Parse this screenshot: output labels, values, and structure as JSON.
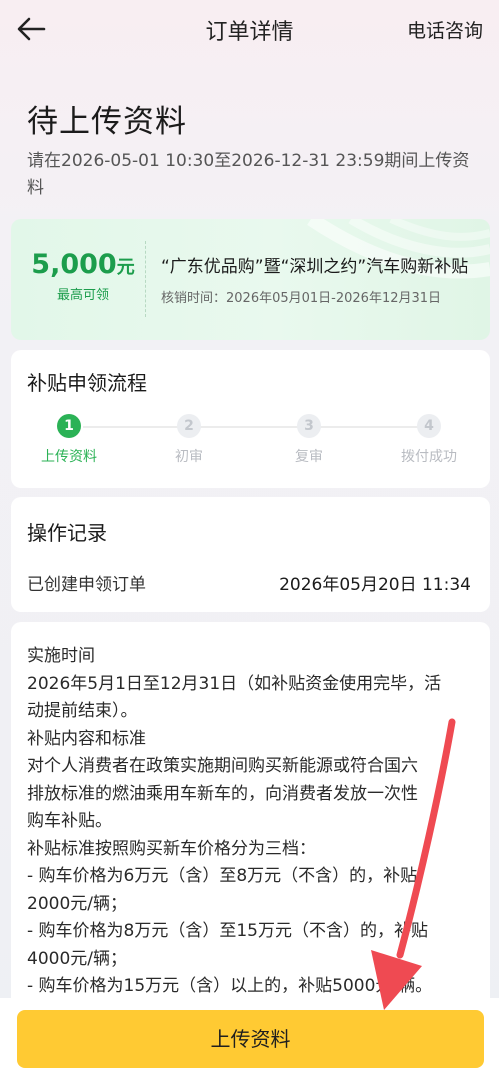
{
  "nav": {
    "title": "订单详情",
    "right_link": "电话咨询",
    "back_icon": "back-arrow-icon"
  },
  "status": {
    "title": "待上传资料",
    "desc": "请在2026-05-01 10:30至2026-12-31 23:59期间上传资料"
  },
  "promo": {
    "amount": "5,000",
    "unit": "元",
    "amount_label": "最高可领",
    "name": "“广东优品购”暨“深圳之约”汽车购新补贴",
    "period": "核销时间：2026年05月01日-2026年12月31日"
  },
  "flow": {
    "title": "补贴申领流程",
    "steps": [
      {
        "num": "1",
        "label": "上传资料",
        "active": true
      },
      {
        "num": "2",
        "label": "初审",
        "active": false
      },
      {
        "num": "3",
        "label": "复审",
        "active": false
      },
      {
        "num": "4",
        "label": "拨付成功",
        "active": false
      }
    ]
  },
  "log": {
    "title": "操作记录",
    "row_label": "已创建申领订单",
    "row_time": "2026年05月20日 11:34"
  },
  "info": {
    "lines": [
      "实施时间",
      "2026年5月1日至12月31日（如补贴资金使用完毕，活",
      "动提前结束）。",
      "补贴内容和标准",
      "对个人消费者在政策实施期间购买新能源或符合国六",
      "排放标准的燃油乘用车新车的，向消费者发放一次性",
      "购车补贴。",
      "补贴标准按照购买新车价格分为三档：",
      "- 购车价格为6万元（含）至8万元（不含）的，补贴",
      "2000元/辆；",
      "- 购车价格为8万元（含）至15万元（不含）的，补贴",
      "4000元/辆；",
      "- 购车价格为15万元（含）以上的，补贴5000元/辆。"
    ]
  },
  "bottom": {
    "button_label": "上传资料"
  },
  "colors": {
    "accent_green": "#2bb256",
    "button_yellow": "#ffca33",
    "annotation_red": "#ef4a52"
  }
}
